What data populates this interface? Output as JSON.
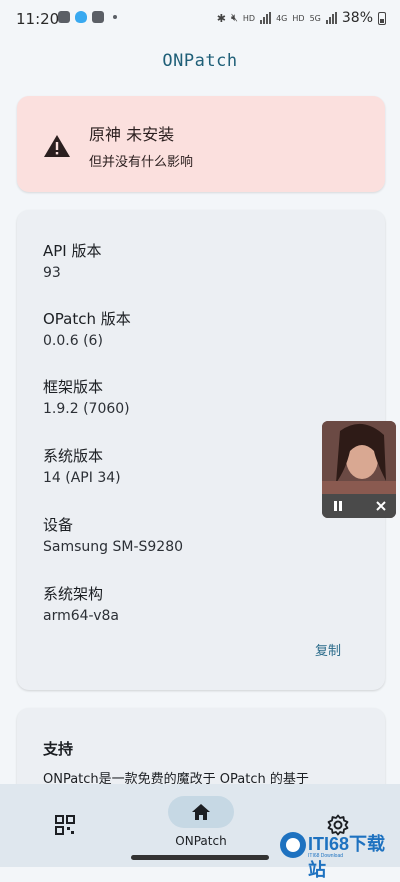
{
  "status_bar": {
    "time": "11:20",
    "battery": "38%",
    "network_labels": [
      "HD",
      "4G",
      "HD",
      "5G"
    ]
  },
  "app": {
    "title": "ONPatch"
  },
  "warning": {
    "title": "原神 未安装",
    "subtitle": "但并没有什么影响",
    "icon": "warning-triangle-icon"
  },
  "info": {
    "items": [
      {
        "label": "API 版本",
        "value": "93"
      },
      {
        "label": "OPatch 版本",
        "value": "0.0.6 (6)"
      },
      {
        "label": "框架版本",
        "value": "1.9.2 (7060)"
      },
      {
        "label": "系统版本",
        "value": "14 (API 34)"
      },
      {
        "label": "设备",
        "value": "Samsung SM-S9280"
      },
      {
        "label": "系统架构",
        "value": "arm64-v8a"
      }
    ],
    "copy_label": "复制"
  },
  "support": {
    "title": "支持",
    "text": "ONPatch是一款免费的魔改于 OPatch 的基于"
  },
  "bottom_nav": {
    "items": [
      {
        "icon": "grid-icon",
        "label": ""
      },
      {
        "icon": "home-icon",
        "label": "ONPatch"
      },
      {
        "icon": "gear-icon",
        "label": ""
      }
    ]
  },
  "watermark": {
    "text": "ITI68下载站",
    "sub": "ITI68 Download"
  },
  "colors": {
    "warning_bg": "#fbe0de",
    "card_bg": "#eceff3",
    "accent": "#1f5f78",
    "nav_bg": "#dfe7ee"
  }
}
